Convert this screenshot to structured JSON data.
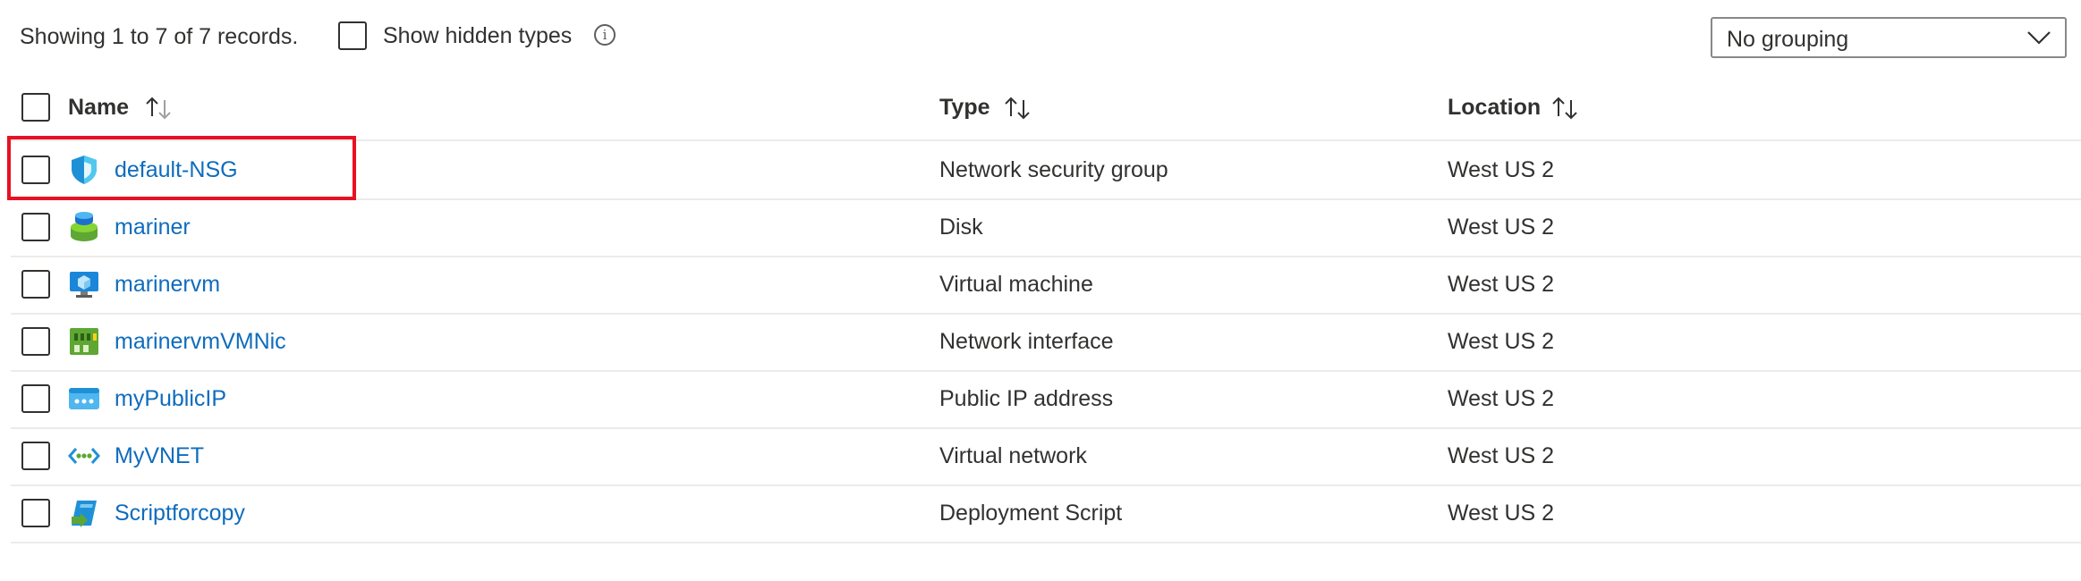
{
  "toolbar": {
    "records_text": "Showing 1 to 7 of 7 records.",
    "show_hidden_label": "Show hidden types",
    "show_hidden_checked": false,
    "info_glyph": "i",
    "grouping_value": "No grouping"
  },
  "columns": {
    "name": "Name",
    "type": "Type",
    "location": "Location"
  },
  "rows": [
    {
      "name": "default-NSG",
      "type": "Network security group",
      "location": "West US 2",
      "icon": "network-security-group-icon"
    },
    {
      "name": "mariner",
      "type": "Disk",
      "location": "West US 2",
      "icon": "disk-icon"
    },
    {
      "name": "marinervm",
      "type": "Virtual machine",
      "location": "West US 2",
      "icon": "virtual-machine-icon"
    },
    {
      "name": "marinervmVMNic",
      "type": "Network interface",
      "location": "West US 2",
      "icon": "network-interface-icon"
    },
    {
      "name": "myPublicIP",
      "type": "Public IP address",
      "location": "West US 2",
      "icon": "public-ip-icon"
    },
    {
      "name": "MyVNET",
      "type": "Virtual network",
      "location": "West US 2",
      "icon": "virtual-network-icon"
    },
    {
      "name": "Scriptforcopy",
      "type": "Deployment Script",
      "location": "West US 2",
      "icon": "deployment-script-icon"
    }
  ],
  "colors": {
    "link": "#0f6cbd",
    "highlight": "#e81123",
    "divider": "#edebe9"
  }
}
